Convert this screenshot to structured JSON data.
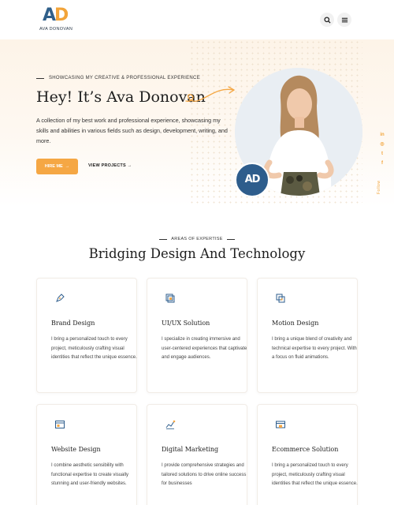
{
  "header": {
    "logo_mark_a": "A",
    "logo_mark_d": "D",
    "logo_name": "AVA DONOVAN",
    "icons": [
      "search-icon",
      "menu-icon"
    ]
  },
  "hero": {
    "eyebrow": "SHOWCASING MY CREATIVE & PROFESSIONAL EXPERIENCE",
    "title": "Hey! It’s Ava Donovan",
    "description": "A collection of my best work and professional experience, showcasing my skills and abilities in various fields such as design, development, writing, and more.",
    "hire_label": "HIRE ME",
    "view_label": "VIEW PROJECTS",
    "badge_text": "AD",
    "social": [
      "in",
      "◎",
      "t",
      "f"
    ],
    "follow_text": "Follow"
  },
  "expertise": {
    "eyebrow": "AREAS OF EXPERTISE",
    "title": "Bridging Design And Technology",
    "cards": [
      {
        "icon": "pen-icon",
        "title": "Brand Design",
        "description": "I bring a personalized touch to every project, meticulously crafting visual identities that reflect the unique essence."
      },
      {
        "icon": "layers-icon",
        "title": "UI/UX Solution",
        "description": "I specialize in creating immersive and user-centered experiences that captivate and engage audiences."
      },
      {
        "icon": "motion-icon",
        "title": "Motion Design",
        "description": "I bring a unique blend of creativity and technical expertise to every project. With a focus on fluid animations."
      },
      {
        "icon": "browser-icon",
        "title": "Website Design",
        "description": "I combine aesthetic sensibility with functional expertise to create visually stunning and user-friendly websites."
      },
      {
        "icon": "marketing-icon",
        "title": "Digital Marketing",
        "description": "I provide comprehensive strategies and tailored solutions to drive online success for businesses"
      },
      {
        "icon": "store-icon",
        "title": "Ecommerce Solution",
        "description": "I bring a personalized touch to every project, meticulously crafting visual identities that reflect the unique essence."
      }
    ]
  },
  "colors": {
    "accent": "#f5a744",
    "brand_blue": "#2e5d8c"
  }
}
